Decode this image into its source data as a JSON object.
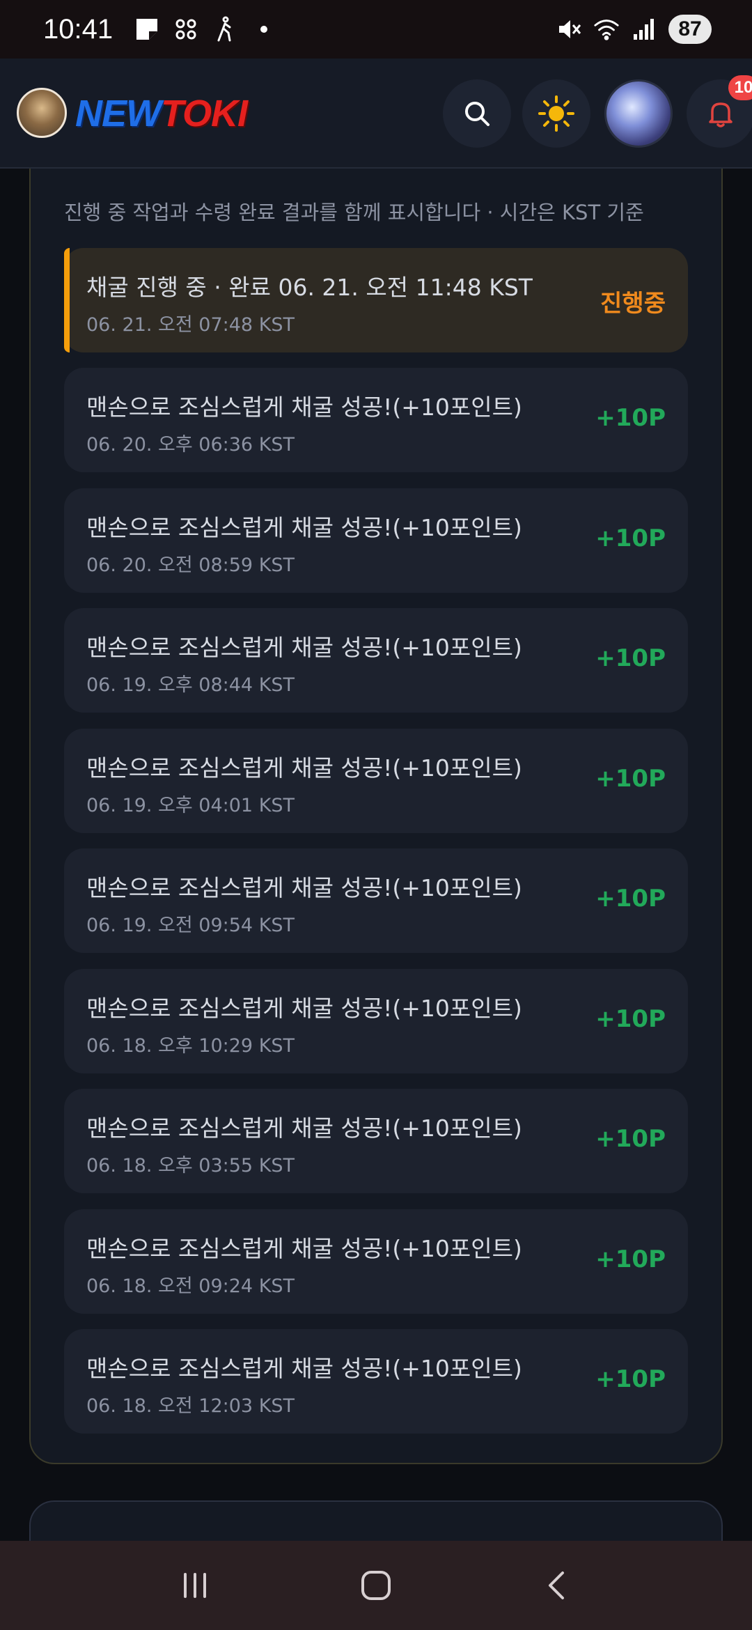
{
  "status_bar": {
    "time": "10:41",
    "battery": "87",
    "icons": [
      "note-icon",
      "grid-icon",
      "walking-icon",
      "dot-icon",
      "mute-icon",
      "wifi-icon",
      "signal-icon"
    ]
  },
  "header": {
    "logo_new": "NEW",
    "logo_toki": "TOKI",
    "notification_count": "10",
    "buttons": [
      "search-icon",
      "sun-icon",
      "profile-avatar",
      "bell-icon"
    ]
  },
  "history": {
    "caption": "진행 중 작업과 수령 완료 결과를 함께 표시합니다 · 시간은 KST 기준",
    "items": [
      {
        "title": "채굴 진행 중 · 완료 06. 21. 오전 11:48 KST",
        "time": "06. 21. 오전 07:48 KST",
        "status": "진행중",
        "active": true
      },
      {
        "title": "맨손으로 조심스럽게 채굴 성공!(+10포인트)",
        "time": "06. 20. 오후 06:36 KST",
        "status": "+10P"
      },
      {
        "title": "맨손으로 조심스럽게 채굴 성공!(+10포인트)",
        "time": "06. 20. 오전 08:59 KST",
        "status": "+10P"
      },
      {
        "title": "맨손으로 조심스럽게 채굴 성공!(+10포인트)",
        "time": "06. 19. 오후 08:44 KST",
        "status": "+10P"
      },
      {
        "title": "맨손으로 조심스럽게 채굴 성공!(+10포인트)",
        "time": "06. 19. 오후 04:01 KST",
        "status": "+10P"
      },
      {
        "title": "맨손으로 조심스럽게 채굴 성공!(+10포인트)",
        "time": "06. 19. 오전 09:54 KST",
        "status": "+10P"
      },
      {
        "title": "맨손으로 조심스럽게 채굴 성공!(+10포인트)",
        "time": "06. 18. 오후 10:29 KST",
        "status": "+10P"
      },
      {
        "title": "맨손으로 조심스럽게 채굴 성공!(+10포인트)",
        "time": "06. 18. 오후 03:55 KST",
        "status": "+10P"
      },
      {
        "title": "맨손으로 조심스럽게 채굴 성공!(+10포인트)",
        "time": "06. 18. 오전 09:24 KST",
        "status": "+10P"
      },
      {
        "title": "맨손으로 조심스럽게 채굴 성공!(+10포인트)",
        "time": "06. 18. 오전 12:03 KST",
        "status": "+10P"
      }
    ]
  },
  "colors": {
    "background": "#0c0e13",
    "card": "#1d222e",
    "active_card": "#2e2a23",
    "accent_orange": "#f08a1d",
    "points_green": "#22a95a",
    "badge_red": "#ef4444"
  },
  "nav_bar": {
    "icons": [
      "recent-apps-icon",
      "home-icon",
      "back-icon"
    ]
  }
}
